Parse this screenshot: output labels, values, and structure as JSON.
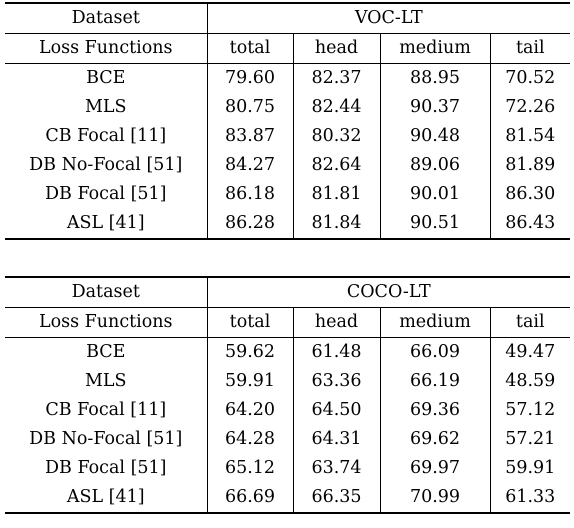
{
  "tables": [
    {
      "id": "voc",
      "corner_label": "Dataset",
      "dataset_name": "VOC-LT",
      "row_header_label": "Loss Functions",
      "columns": [
        "total",
        "head",
        "medium",
        "tail"
      ],
      "rows": [
        {
          "label": "BCE",
          "values": [
            "79.60",
            "82.37",
            "88.95",
            "70.52"
          ],
          "bold": [
            false,
            false,
            false,
            false
          ]
        },
        {
          "label": "MLS",
          "values": [
            "80.75",
            "82.44",
            "90.37",
            "72.26"
          ],
          "bold": [
            false,
            false,
            false,
            false
          ]
        },
        {
          "label": "CB Focal [11]",
          "values": [
            "83.87",
            "80.32",
            "90.48",
            "81.54"
          ],
          "bold": [
            false,
            false,
            false,
            false
          ]
        },
        {
          "label": "DB No-Focal [51]",
          "values": [
            "84.27",
            "82.64",
            "89.06",
            "81.89"
          ],
          "bold": [
            false,
            true,
            false,
            false
          ]
        },
        {
          "label": "DB Focal [51]",
          "values": [
            "86.18",
            "81.81",
            "90.01",
            "86.30"
          ],
          "bold": [
            false,
            false,
            false,
            false
          ]
        },
        {
          "label": "ASL [41]",
          "values": [
            "86.28",
            "81.84",
            "90.51",
            "86.43"
          ],
          "bold": [
            true,
            false,
            true,
            true
          ]
        }
      ]
    },
    {
      "id": "coco",
      "corner_label": "Dataset",
      "dataset_name": "COCO-LT",
      "row_header_label": "Loss Functions",
      "columns": [
        "total",
        "head",
        "medium",
        "tail"
      ],
      "rows": [
        {
          "label": "BCE",
          "values": [
            "59.62",
            "61.48",
            "66.09",
            "49.47"
          ],
          "bold": [
            false,
            false,
            false,
            false
          ]
        },
        {
          "label": "MLS",
          "values": [
            "59.91",
            "63.36",
            "66.19",
            "48.59"
          ],
          "bold": [
            false,
            false,
            false,
            false
          ]
        },
        {
          "label": "CB Focal [11]",
          "values": [
            "64.20",
            "64.50",
            "69.36",
            "57.12"
          ],
          "bold": [
            false,
            false,
            false,
            false
          ]
        },
        {
          "label": "DB No-Focal [51]",
          "values": [
            "64.28",
            "64.31",
            "69.62",
            "57.21"
          ],
          "bold": [
            false,
            false,
            false,
            false
          ]
        },
        {
          "label": "DB Focal [51]",
          "values": [
            "65.12",
            "63.74",
            "69.97",
            "59.91"
          ],
          "bold": [
            false,
            false,
            false,
            false
          ]
        },
        {
          "label": "ASL [41]",
          "values": [
            "66.69",
            "66.35",
            "70.99",
            "61.33"
          ],
          "bold": [
            true,
            true,
            true,
            true
          ]
        }
      ]
    }
  ]
}
